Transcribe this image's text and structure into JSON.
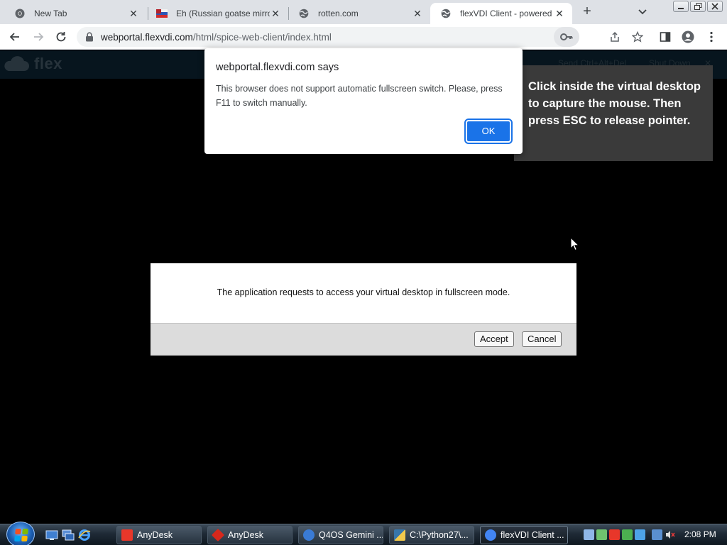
{
  "browser": {
    "tabs": [
      {
        "title": "New Tab",
        "icon": "chrome-icon"
      },
      {
        "title": "Eh (Russian goatse mirror",
        "icon": "flag-icon"
      },
      {
        "title": "rotten.com",
        "icon": "globe-icon"
      },
      {
        "title": "flexVDI Client - powered",
        "icon": "globe-icon",
        "active": true
      }
    ],
    "url": {
      "host": "webportal.flexvdi.com",
      "path": "/html/spice-web-client/index.html"
    }
  },
  "page": {
    "brand": "flex",
    "header_links": [
      "...",
      "Send Ctrl+Alt+Del",
      "Shut Down",
      "✕"
    ],
    "tooltip": "Click inside the virtual desktop to capture the mouse. Then press ESC to release pointer.",
    "fullscreen_dialog": {
      "message": "The application requests to access your virtual desktop in fullscreen mode.",
      "accept_label": "Accept",
      "cancel_label": "Cancel"
    }
  },
  "alert": {
    "title": "webportal.flexvdi.com says",
    "message": "This browser does not support automatic fullscreen switch. Please, press F11 to switch manually.",
    "ok_label": "OK"
  },
  "taskbar": {
    "items": [
      {
        "label": "AnyDesk",
        "icon_color": "#e8372a"
      },
      {
        "label": "AnyDesk",
        "icon_color": "#d8281c"
      },
      {
        "label": "Q4OS Gemini ...",
        "icon_color": "#3a7bd5"
      },
      {
        "label": "C:\\Python27\\...",
        "icon_color": "#f2c94c"
      },
      {
        "label": "flexVDI Client ...",
        "icon_color": "#4285f4",
        "active": true
      }
    ],
    "clock": "2:08 PM"
  },
  "colors": {
    "alert_button": "#1a73e8",
    "tooltip_bg": "#3a3a3a"
  }
}
